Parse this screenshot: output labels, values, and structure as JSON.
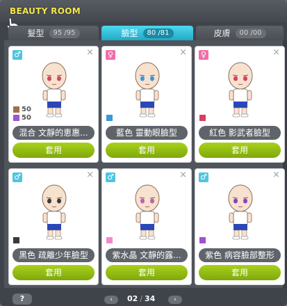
{
  "window": {
    "title": "BEAUTY ROOM"
  },
  "tabs": [
    {
      "label": "髮型",
      "count": "95 /95",
      "active": false
    },
    {
      "label": "臉型",
      "count": "80 /81",
      "active": true
    },
    {
      "label": "皮膚",
      "count": "00 /00",
      "active": false
    }
  ],
  "cards": [
    {
      "gender": "♂",
      "gender_color": "#4fc5e0",
      "name": "混合 文靜的恵惠...",
      "apply_label": "套用",
      "mix": [
        {
          "color": "#a0704a",
          "value": "50"
        },
        {
          "color": "#9b59d0",
          "value": "50"
        }
      ],
      "eye_color": "#d04a5a"
    },
    {
      "gender": "♀",
      "gender_color": "#f06fa8",
      "name": "藍色 靈動眼臉型",
      "apply_label": "套用",
      "swatch": "#3a98d8",
      "eye_color": "#3a98d8"
    },
    {
      "gender": "♀",
      "gender_color": "#f06fa8",
      "name": "紅色 影武者臉型",
      "apply_label": "套用",
      "swatch": "#d84060",
      "eye_color": "#d84060"
    },
    {
      "gender": "♂",
      "gender_color": "#4fc5e0",
      "name": "黑色 疏離少年臉型",
      "apply_label": "套用",
      "swatch": "#3a3a3a",
      "eye_color": "#3a3a3a"
    },
    {
      "gender": "♂",
      "gender_color": "#4fc5e0",
      "name": "紫水晶 文靜的露...",
      "apply_label": "套用",
      "swatch": "#f08ad0",
      "eye_color": "#c060b0"
    },
    {
      "gender": "♂",
      "gender_color": "#4fc5e0",
      "name": "紫色 病容臉部整形",
      "apply_label": "套用",
      "swatch": "#a050d0",
      "eye_color": "#8a40c0"
    }
  ],
  "pagination": {
    "current": "02",
    "separator": "/",
    "total": "34",
    "prev_icon": "chevron-left-icon",
    "next_icon": "chevron-right-icon"
  },
  "help": {
    "label": "?"
  }
}
